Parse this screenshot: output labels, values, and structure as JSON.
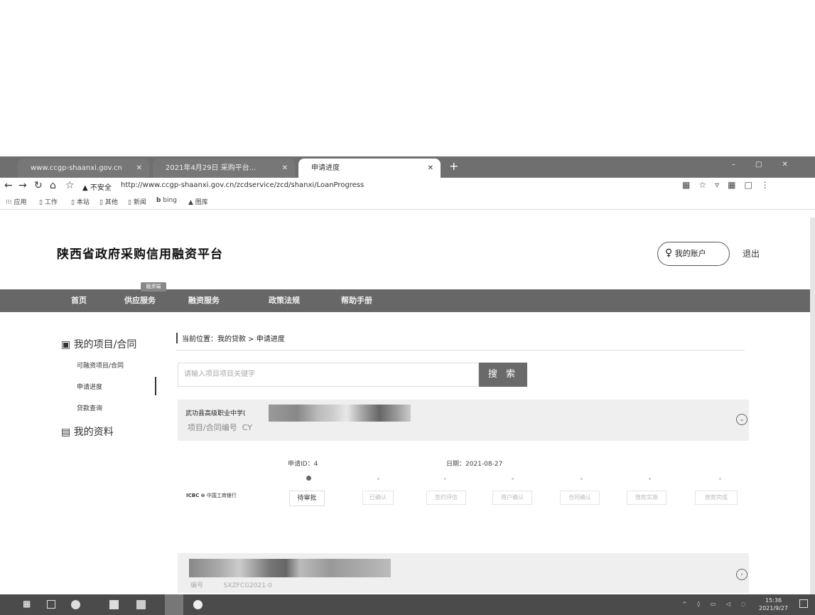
{
  "browser": {
    "tabs": [
      {
        "label": "www.ccgp-shaanxi.gov.cn",
        "active": false
      },
      {
        "label": "2021年4月29日 采购平台...",
        "active": false
      },
      {
        "label": "申请进度",
        "active": true
      }
    ],
    "new_tab": "+",
    "address": {
      "security": "不安全",
      "url": "http://www.ccgp-shaanxi.gov.cn/zcdservice/zcd/shanxi/LoanProgress"
    },
    "bookmarks": [
      "应用",
      "工作",
      "本站",
      "其他",
      "新闻",
      "bing",
      "图库"
    ]
  },
  "header": {
    "site_title": "陕西省政府采购信用融资平台",
    "account_label": "我的账户",
    "logout_label": "退出"
  },
  "nav": {
    "badge": "融资端",
    "items": [
      "首页",
      "供应服务",
      "融资服务",
      "政策法规",
      "帮助手册"
    ]
  },
  "sidebar": {
    "section1": "我的项目/合同",
    "items": [
      "可融资项目/合同",
      "申请进度",
      "贷款查询"
    ],
    "section2": "我的资料"
  },
  "main": {
    "breadcrumb": "当前位置：我的贷款 > 申请进度",
    "search": {
      "placeholder": "请输入项目项目关键字",
      "button": "搜 索"
    },
    "cards": [
      {
        "title": "武功县高级职业中学(",
        "subtitle": "项目/合同编号",
        "subtitle_val": "CY",
        "apply_amount": "申请ID：4",
        "apply_date": "日期：2021-08-27",
        "bank": "中国工商银行",
        "steps": [
          "待审批",
          "已确认",
          "签约评估",
          "用户确认",
          "合同确认",
          "放款实施",
          "放款完成"
        ],
        "current_step": 0
      },
      {
        "subtitle": "编号",
        "subtitle_val": "SXZFCG2021-0"
      }
    ]
  },
  "taskbar": {
    "time": "15:36",
    "date": "2021/9/27"
  },
  "colors": {
    "nav": "#676767",
    "button": "#6a6a6a",
    "card": "#efefef"
  }
}
